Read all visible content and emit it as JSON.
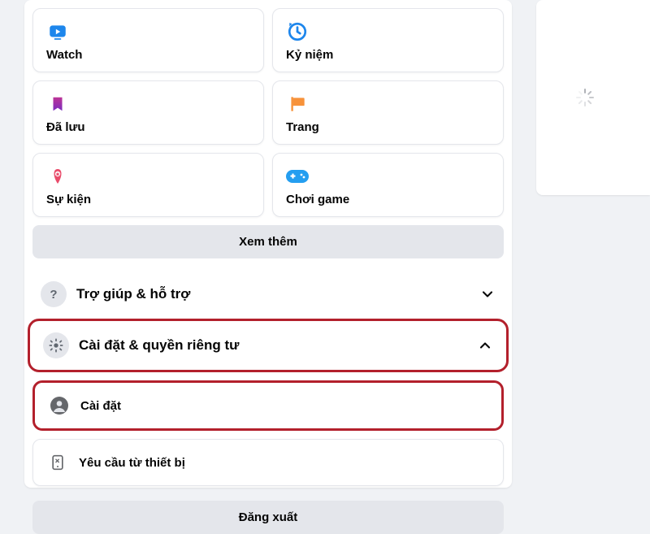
{
  "grid": {
    "watch": "Watch",
    "memories": "Kỷ niệm",
    "saved": "Đã lưu",
    "pages": "Trang",
    "events": "Sự kiện",
    "gaming": "Chơi game"
  },
  "see_more": "Xem thêm",
  "help_support": "Trợ giúp & hỗ trợ",
  "settings_privacy": "Cài đặt & quyền riêng tư",
  "settings": "Cài đặt",
  "device_requests": "Yêu cầu từ thiết bị",
  "logout": "Đăng xuất"
}
